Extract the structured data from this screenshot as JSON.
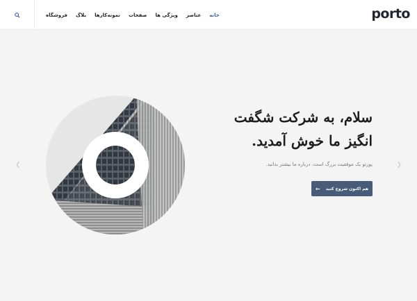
{
  "header": {
    "logo": "porto",
    "search_icon": "search-icon",
    "nav": [
      {
        "label": "خانه",
        "active": true
      },
      {
        "label": "عناصر"
      },
      {
        "label": "ویژگی ها"
      },
      {
        "label": "صفحات"
      },
      {
        "label": "نمونه‌کارها"
      },
      {
        "label": "بلاگ"
      },
      {
        "label": "فروشگاه"
      }
    ]
  },
  "hero": {
    "headline_line1": "سلام، به شرکت شگفت",
    "headline_line2": "انگیز ما خوش آمدید.",
    "subtitle": "پورتو یک موفقیت بزرگ است، درباره ما بیشتر بدانید.",
    "cta_label": "هم اکنون شروع کنید",
    "cta_icon": "arrow-left-icon"
  },
  "slider": {
    "prev_icon": "chevron-left-icon",
    "next_icon": "chevron-right-icon"
  },
  "colors": {
    "accent": "#3a5fa8",
    "button": "#485b78",
    "background": "#f4f4f4"
  }
}
